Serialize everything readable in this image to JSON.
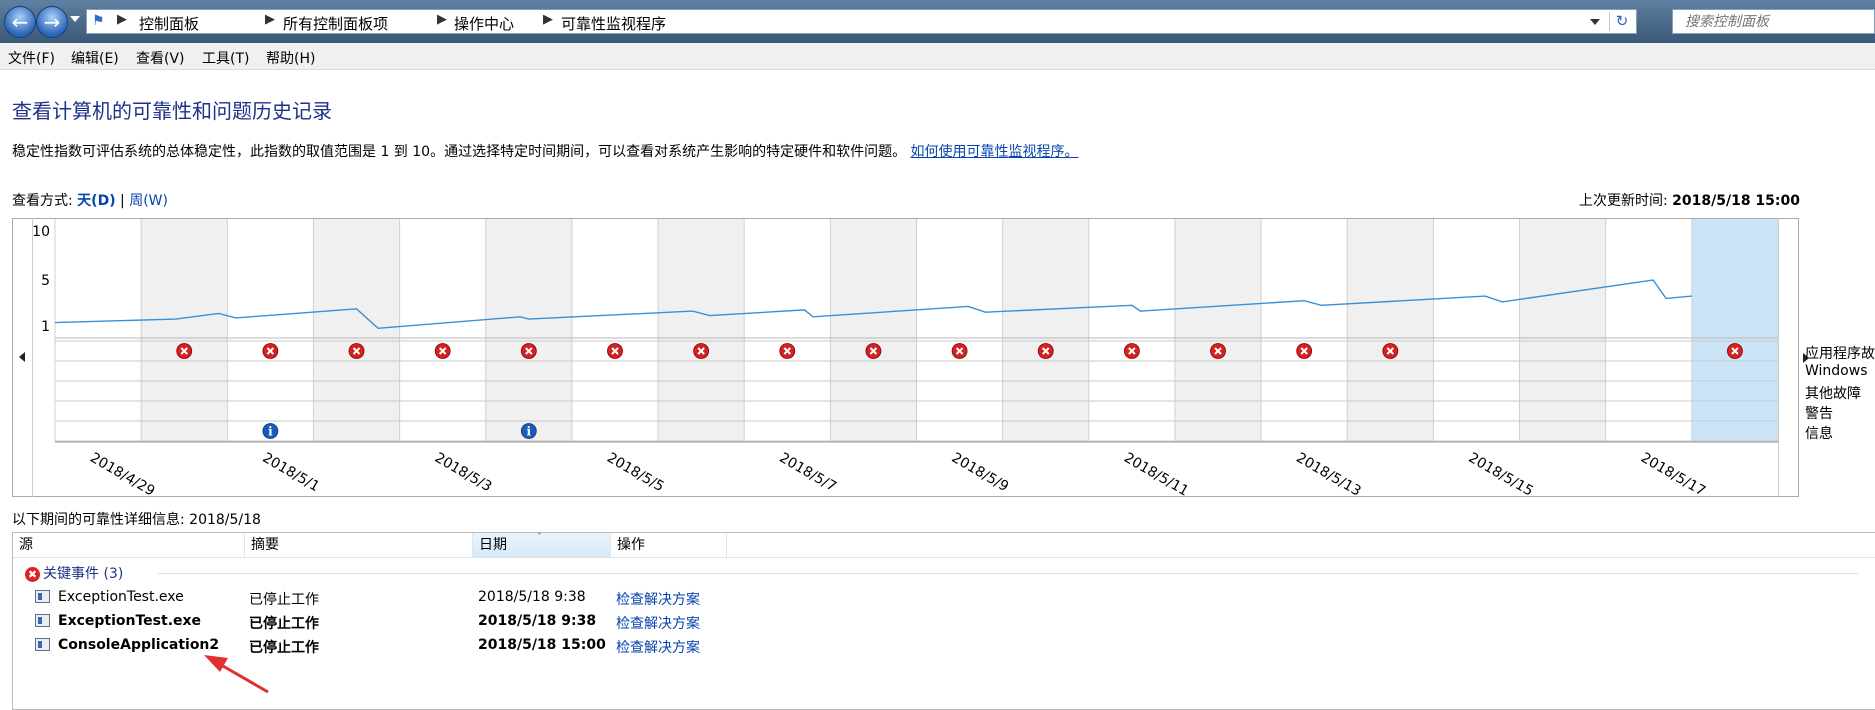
{
  "address_bar": {
    "breadcrumb": [
      "控制面板",
      "所有控制面板项",
      "操作中心",
      "可靠性监视程序"
    ],
    "search_placeholder": "搜索控制面板"
  },
  "menu": [
    "文件(F)",
    "编辑(E)",
    "查看(V)",
    "工具(T)",
    "帮助(H)"
  ],
  "page": {
    "title": "查看计算机的可靠性和问题历史记录",
    "description": "稳定性指数可评估系统的总体稳定性，此指数的取值范围是 1 到 10。通过选择特定时间期间，可以查看对系统产生影响的特定硬件和软件问题。",
    "help_link": "如何使用可靠性监视程序。",
    "view_by_label": "查看方式:",
    "view_day": "天(D)",
    "view_sep": "|",
    "view_week": "周(W)",
    "last_updated_label": "上次更新时间:",
    "last_updated_value": "2018/5/18 15:00"
  },
  "chart_data": {
    "type": "line",
    "y_ticks": [
      "10",
      "5",
      "1"
    ],
    "ylim": [
      1,
      10
    ],
    "x_labels": [
      "2018/4/29",
      "2018/5/1",
      "2018/5/3",
      "2018/5/5",
      "2018/5/7",
      "2018/5/9",
      "2018/5/11",
      "2018/5/13",
      "2018/5/15",
      "2018/5/17"
    ],
    "columns": 20,
    "selected_column": 19,
    "stability_index": [
      [
        0,
        1.3
      ],
      [
        1.4,
        1.6
      ],
      [
        1.9,
        2.1
      ],
      [
        2.1,
        1.7
      ],
      [
        3.5,
        2.5
      ],
      [
        3.75,
        0.8
      ],
      [
        5.4,
        1.8
      ],
      [
        5.5,
        1.6
      ],
      [
        7.4,
        2.3
      ],
      [
        7.6,
        1.9
      ],
      [
        8.7,
        2.4
      ],
      [
        8.8,
        1.8
      ],
      [
        10.6,
        2.7
      ],
      [
        10.8,
        2.2
      ],
      [
        12.5,
        2.8
      ],
      [
        12.6,
        2.3
      ],
      [
        14.5,
        3.2
      ],
      [
        14.7,
        2.8
      ],
      [
        16.6,
        3.6
      ],
      [
        16.8,
        3.1
      ],
      [
        18.55,
        5.0
      ],
      [
        18.7,
        3.4
      ],
      [
        19.0,
        3.6
      ]
    ],
    "event_rows": [
      "应用程序故障",
      "Windows",
      "其他故障",
      "警告",
      "信息"
    ],
    "critical_events_columns": [
      1,
      2,
      3,
      4,
      5,
      6,
      7,
      8,
      9,
      10,
      11,
      12,
      13,
      14,
      15,
      19
    ],
    "info_events_columns": [
      2,
      5
    ]
  },
  "details": {
    "label": "以下期间的可靠性详细信息: 2018/5/18",
    "columns": [
      "源",
      "摘要",
      "日期",
      "操作"
    ],
    "group_label": "关键事件 (3)",
    "rows": [
      {
        "source": "ExceptionTest.exe",
        "summary": "已停止工作",
        "date": "2018/5/18 9:38",
        "action": "检查解决方案",
        "bold": false
      },
      {
        "source": "ExceptionTest.exe",
        "summary": "已停止工作",
        "date": "2018/5/18 9:38",
        "action": "检查解决方案",
        "bold": true
      },
      {
        "source": "ConsoleApplication2",
        "summary": "已停止工作",
        "date": "2018/5/18 15:00",
        "action": "检查解决方案",
        "bold": true
      }
    ]
  },
  "colors": {
    "title": "#1e3287",
    "link": "#0645ad",
    "line": "#3a8fd6",
    "selected_column": "#cce4f7",
    "shaded_column": "#f0f0f0",
    "critical_icon": "#d22222",
    "info_icon": "#1a5bb8",
    "annotation_arrow": "#e03030"
  }
}
